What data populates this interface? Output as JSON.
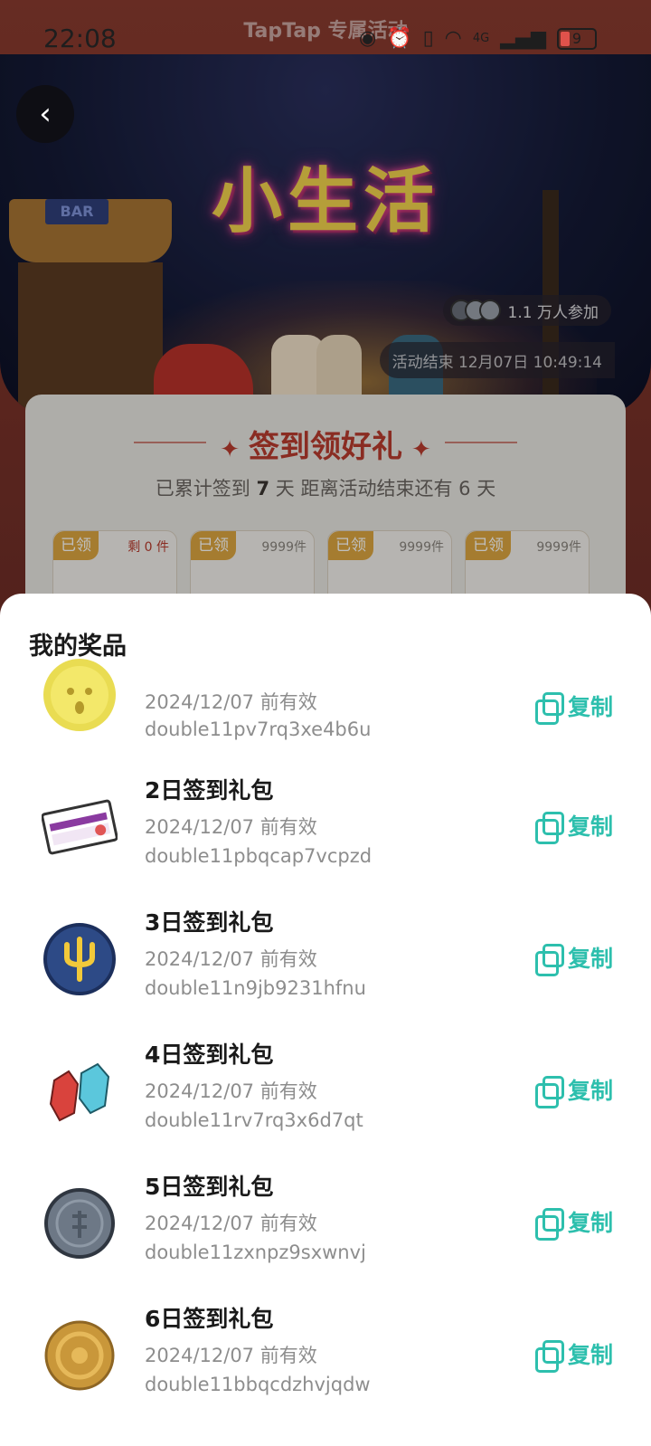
{
  "status_bar": {
    "time": "22:08",
    "network": "4G",
    "battery": "9"
  },
  "header": {
    "brand": "TapTap 专属活动",
    "title_art": "小生活",
    "bar_sign": "BAR",
    "participants": "1.1 万人参加",
    "end_time": "活动结束 12月07日 10:49:14"
  },
  "checkin": {
    "title": "签到领好礼",
    "subtitle_prefix": "已累计签到",
    "days_signed": "7",
    "subtitle_mid": "天  距离活动结束还有",
    "days_left": "6",
    "subtitle_suffix": "天",
    "cards": [
      {
        "tag": "已领",
        "stock": "剩 0 件"
      },
      {
        "tag": "已领",
        "stock": "9999件"
      },
      {
        "tag": "已领",
        "stock": "9999件"
      },
      {
        "tag": "已领",
        "stock": "9999件"
      }
    ]
  },
  "sheet": {
    "title": "我的奖品",
    "copy_label": "复制",
    "prizes": [
      {
        "name": "",
        "expiry": "2024/12/07 前有效",
        "code": "double11pv7rq3xe4b6u",
        "icon": "yellow-face-coin-icon"
      },
      {
        "name": "2日签到礼包",
        "expiry": "2024/12/07 前有效",
        "code": "double11pbqcap7vcpzd",
        "icon": "voucher-ticket-icon"
      },
      {
        "name": "3日签到礼包",
        "expiry": "2024/12/07 前有效",
        "code": "double11n9jb9231hfnu",
        "icon": "trident-badge-icon"
      },
      {
        "name": "4日签到礼包",
        "expiry": "2024/12/07 前有效",
        "code": "double11rv7rq3x6d7qt",
        "icon": "crystals-icon"
      },
      {
        "name": "5日签到礼包",
        "expiry": "2024/12/07 前有效",
        "code": "double11zxnpz9sxwnvj",
        "icon": "silver-coin-icon"
      },
      {
        "name": "6日签到礼包",
        "expiry": "2024/12/07 前有效",
        "code": "double11bbqcdzhvjqdw",
        "icon": "gold-coin-icon"
      }
    ]
  },
  "colors": {
    "accent": "#2dbfad",
    "checkin_red": "#b83b2e",
    "tag_gold": "#dca640"
  }
}
